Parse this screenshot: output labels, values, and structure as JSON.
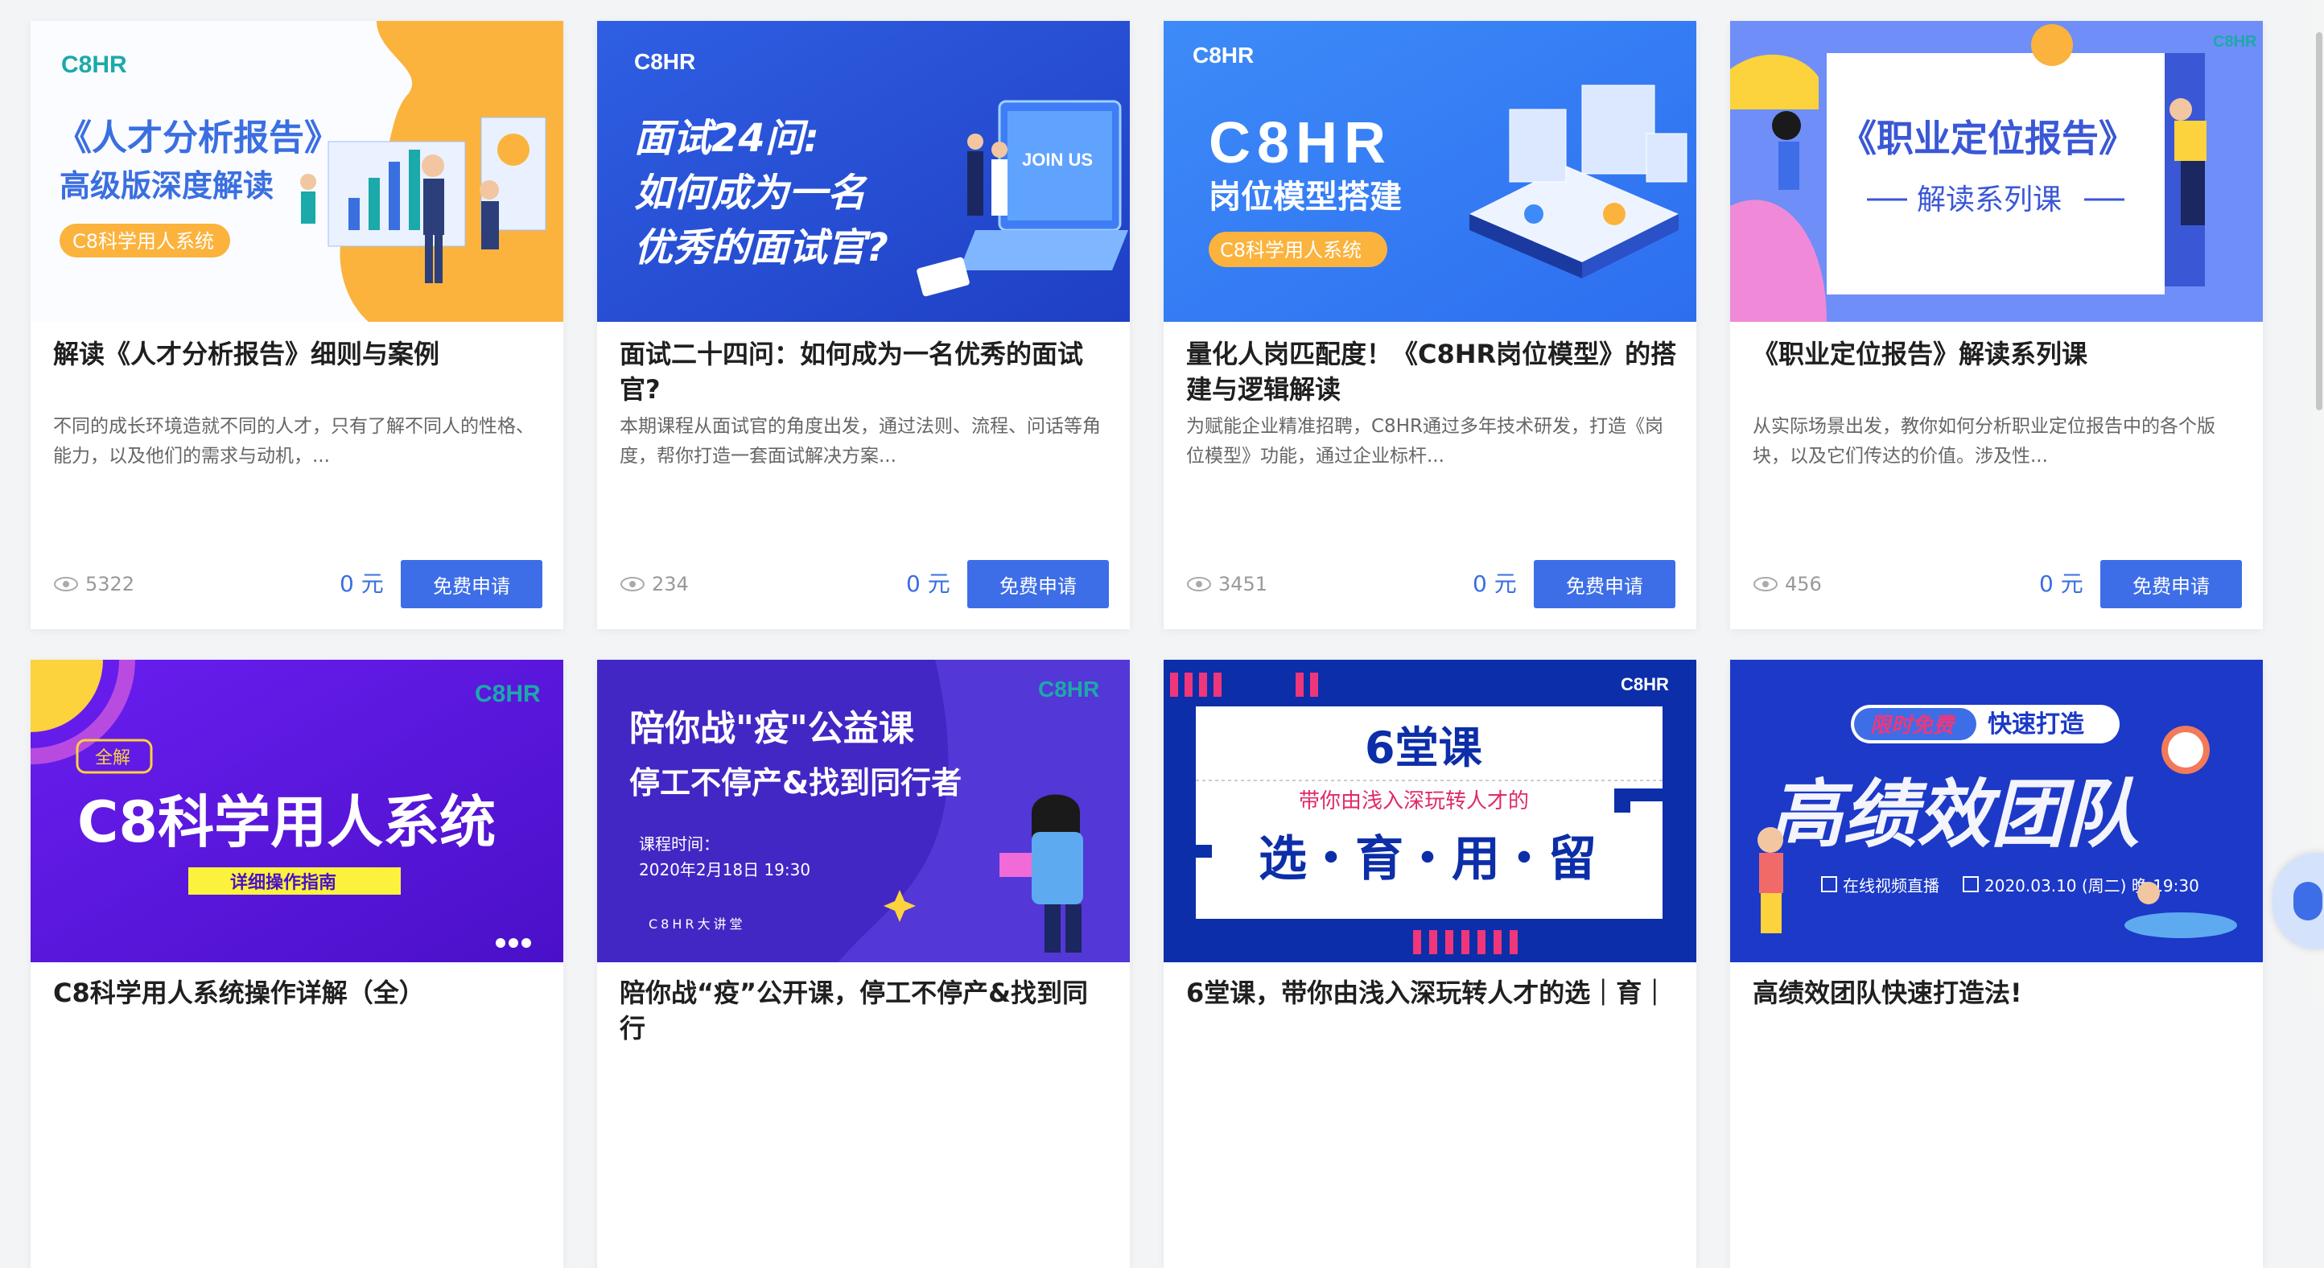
{
  "currency_unit": "元",
  "apply_label": "免费申请",
  "colors": {
    "accent": "#3d6ee7",
    "price": "#3a6fe0",
    "card_bg": "#ffffff",
    "page_bg": "#f3f4f6"
  },
  "courses": [
    {
      "banner": {
        "logo": "C8HR",
        "line1": "《人才分析报告》",
        "line2": "高级版深度解读",
        "tag": "C8科学用人系统"
      },
      "title": "解读《人才分析报告》细则与案例",
      "desc": "不同的成长环境造就不同的人才，只有了解不同人的性格、能力，以及他们的需求与动机，...",
      "views": "5322",
      "price": "0"
    },
    {
      "banner": {
        "logo": "C8HR",
        "line1": "面试24问:",
        "line2": "如何成为一名",
        "line3": "优秀的面试官?",
        "tag": "JOIN US"
      },
      "title": "面试二十四问：如何成为一名优秀的面试官?",
      "desc": "本期课程从面试官的角度出发，通过法则、流程、问话等角度，帮你打造一套面试解决方案...",
      "views": "234",
      "price": "0"
    },
    {
      "banner": {
        "logo": "C8HR",
        "line1": "C8HR",
        "line2": "岗位模型搭建",
        "tag": "C8科学用人系统"
      },
      "title": "量化人岗匹配度！《C8HR岗位模型》的搭建与逻辑解读",
      "desc": "为赋能企业精准招聘，C8HR通过多年技术研发，打造《岗位模型》功能，通过企业标杆...",
      "views": "3451",
      "price": "0"
    },
    {
      "banner": {
        "logo": "C8HR",
        "line1": "《职业定位报告》",
        "line2": "解读系列课"
      },
      "title": "《职业定位报告》解读系列课",
      "desc": "从实际场景出发，教你如何分析职业定位报告中的各个版块，以及它们传达的价值。涉及性...",
      "views": "456",
      "price": "0"
    },
    {
      "banner": {
        "logo": "C8HR",
        "badge": "全解",
        "line1": "C8科学用人系统",
        "tag": "详细操作指南"
      },
      "title": "C8科学用人系统操作详解（全）"
    },
    {
      "banner": {
        "logo": "C8HR",
        "line1": "陪你战\"疫\"公益课",
        "line2": "停工不停产&找到同行者",
        "line3": "课程时间：",
        "line4": "2020年2月18日  19:30",
        "footer": "C8HR大讲堂"
      },
      "title": "陪你战“疫”公开课，停工不停产&找到同行"
    },
    {
      "banner": {
        "logo": "C8HR",
        "line1": "6堂课",
        "line2": "带你由浅入深玩转人才的",
        "line3": "选・育・用・留"
      },
      "title": "6堂课，带你由浅入深玩转人才的选｜育｜"
    },
    {
      "banner": {
        "logo": "C8HR",
        "badge": "限时免费",
        "line0": "快速打造",
        "line1": "高绩效团队",
        "line2": "在线视频直播",
        "line3": "2020.03.10 (周二) 晚 19:30"
      },
      "title": "高绩效团队快速打造法!"
    }
  ]
}
